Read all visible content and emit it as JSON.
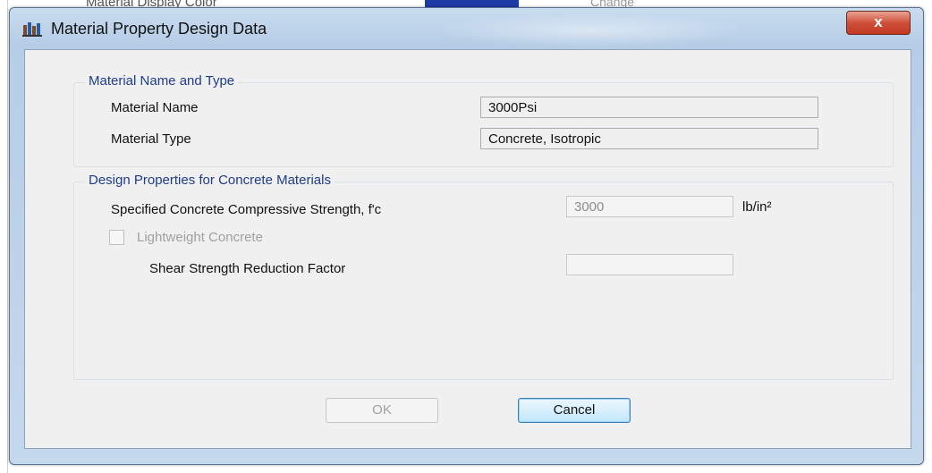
{
  "background": {
    "partial_text": "Material Display Color",
    "partial_text_2": "Change"
  },
  "dialog": {
    "title": "Material Property Design Data",
    "close_label": "x",
    "name_type_group": {
      "title": "Material Name and Type",
      "material_name_label": "Material Name",
      "material_name_value": "3000Psi",
      "material_type_label": "Material Type",
      "material_type_value": "Concrete, Isotropic"
    },
    "concrete_group": {
      "title": "Design Properties for Concrete Materials",
      "fc_label": "Specified Concrete Compressive Strength, f'c",
      "fc_value": "3000",
      "fc_unit": "lb/in²",
      "lightweight_label": "Lightweight Concrete",
      "lightweight_checked": false,
      "shear_factor_label": "Shear Strength Reduction Factor",
      "shear_factor_value": ""
    },
    "buttons": {
      "ok": "OK",
      "cancel": "Cancel"
    }
  }
}
